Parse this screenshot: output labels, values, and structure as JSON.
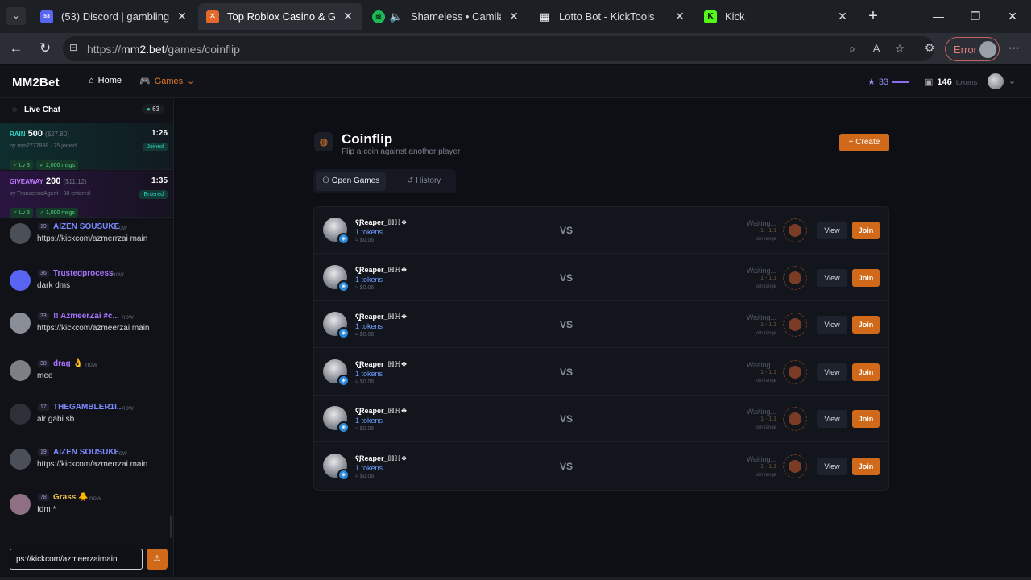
{
  "browser": {
    "tabs": [
      {
        "title": "(53) Discord | gambling",
        "badge": "53"
      },
      {
        "title": "Top Roblox Casino & Gambl",
        "active": true
      },
      {
        "title": "Shameless • Camila Cab"
      },
      {
        "title": "Lotto Bot - KickTools"
      },
      {
        "title": "Kick"
      }
    ],
    "url_prefix": "https://",
    "url_host": "mm2.bet",
    "url_path": "/games/coinflip",
    "error_label": "Error"
  },
  "site": {
    "logo": "MM2Bet",
    "nav_home": "Home",
    "nav_games": "Games",
    "stars": "33",
    "tokens_value": "146",
    "tokens_label": "tokens"
  },
  "chat": {
    "title": "Live Chat",
    "online": "63",
    "rain": {
      "label": "RAIN",
      "amount": "500",
      "usd": "($27.80)",
      "meta": "by mm2777888 · 75 joined",
      "time": "1:26",
      "state": "Joined",
      "req1": "✓ Lv 3",
      "req2": "✓ 2,000 msgs"
    },
    "giveaway": {
      "label": "GIVEAWAY",
      "amount": "200",
      "usd": "($11.12)",
      "meta": "by TranscendAgent · 88 entered",
      "time": "1:35",
      "state": "Entered",
      "req1": "✓ Lv 5",
      "req2": "✓ 1,000 msgs"
    },
    "messages": [
      {
        "level": "19",
        "name": "AIZEN SOUSUKE",
        "time": "now",
        "text": "https://kickcom/azmerrzai main",
        "name_color": "#7c88ff",
        "avatar_color": "#4b4f57"
      },
      {
        "level": "36",
        "name": "Trustedprocess",
        "time": "now",
        "text": "dark dms",
        "name_color": "#a874ff",
        "avatar_color": "#5865f2"
      },
      {
        "level": "33",
        "name": "!! AzmeerZai #c...",
        "time": "now",
        "text": "https://kickcom/azmeerzai main",
        "name_color": "#a874ff",
        "avatar_color": "#8a8e96"
      },
      {
        "level": "38",
        "name": "drag 👌",
        "time": "now",
        "text": "mee",
        "name_color": "#a874ff",
        "avatar_color": "#7d7f84"
      },
      {
        "level": "17",
        "name": "THEGAMBLER1I...",
        "time": "now",
        "text": "alr gabi sb",
        "name_color": "#7c88ff",
        "avatar_color": "#2e3038"
      },
      {
        "level": "19",
        "name": "AIZEN SOUSUKE",
        "time": "now",
        "text": "https://kickcom/azmerrzai main",
        "name_color": "#7c88ff",
        "avatar_color": "#4b4f57"
      },
      {
        "level": "78",
        "name": "Grass 🐥",
        "time": "now",
        "text": "Idm *",
        "name_color": "#f0c24a",
        "avatar_color": "#8e6f84"
      }
    ],
    "input_value": "ps://kickcom/azmeerzaimain"
  },
  "coinflip": {
    "title": "Coinflip",
    "subtitle": "Flip a coin against another player",
    "create_label": "+ Create",
    "tab_open": "Open Games",
    "tab_history": "History",
    "games": [
      {
        "player": "ʕ̡̢̡Reaper_ℍℍ❖",
        "tokens": "1 tokens",
        "usd": "≈ $0.06",
        "vs": "VS",
        "status": "Waiting...",
        "range": "1 - 1.1",
        "range_label": "join range",
        "view": "View",
        "join": "Join"
      },
      {
        "player": "ʕ̡̢̡Reaper_ℍℍ❖",
        "tokens": "1 tokens",
        "usd": "≈ $0.06",
        "vs": "VS",
        "status": "Waiting...",
        "range": "1 - 1.1",
        "range_label": "join range",
        "view": "View",
        "join": "Join"
      },
      {
        "player": "ʕ̡̢̡Reaper_ℍℍ❖",
        "tokens": "1 tokens",
        "usd": "≈ $0.06",
        "vs": "VS",
        "status": "Waiting...",
        "range": "1 - 1.1",
        "range_label": "join range",
        "view": "View",
        "join": "Join"
      },
      {
        "player": "ʕ̡̢̡Reaper_ℍℍ❖",
        "tokens": "1 tokens",
        "usd": "≈ $0.06",
        "vs": "VS",
        "status": "Waiting...",
        "range": "1 - 1.1",
        "range_label": "join range",
        "view": "View",
        "join": "Join"
      },
      {
        "player": "ʕ̡̢̡Reaper_ℍℍ❖",
        "tokens": "1 tokens",
        "usd": "≈ $0.06",
        "vs": "VS",
        "status": "Waiting...",
        "range": "1 - 1.1",
        "range_label": "join range",
        "view": "View",
        "join": "Join"
      },
      {
        "player": "ʕ̡̢̡Reaper_ℍℍ❖",
        "tokens": "1 tokens",
        "usd": "≈ $0.06",
        "vs": "VS",
        "status": "Waiting...",
        "range": "1 - 1.1",
        "range_label": "join range",
        "view": "View",
        "join": "Join"
      }
    ]
  },
  "colors": {
    "accent": "#d06a1a",
    "tokens_blue": "#6b9cff",
    "rain": "#2fd0c0",
    "giveaway": "#b064ff"
  }
}
